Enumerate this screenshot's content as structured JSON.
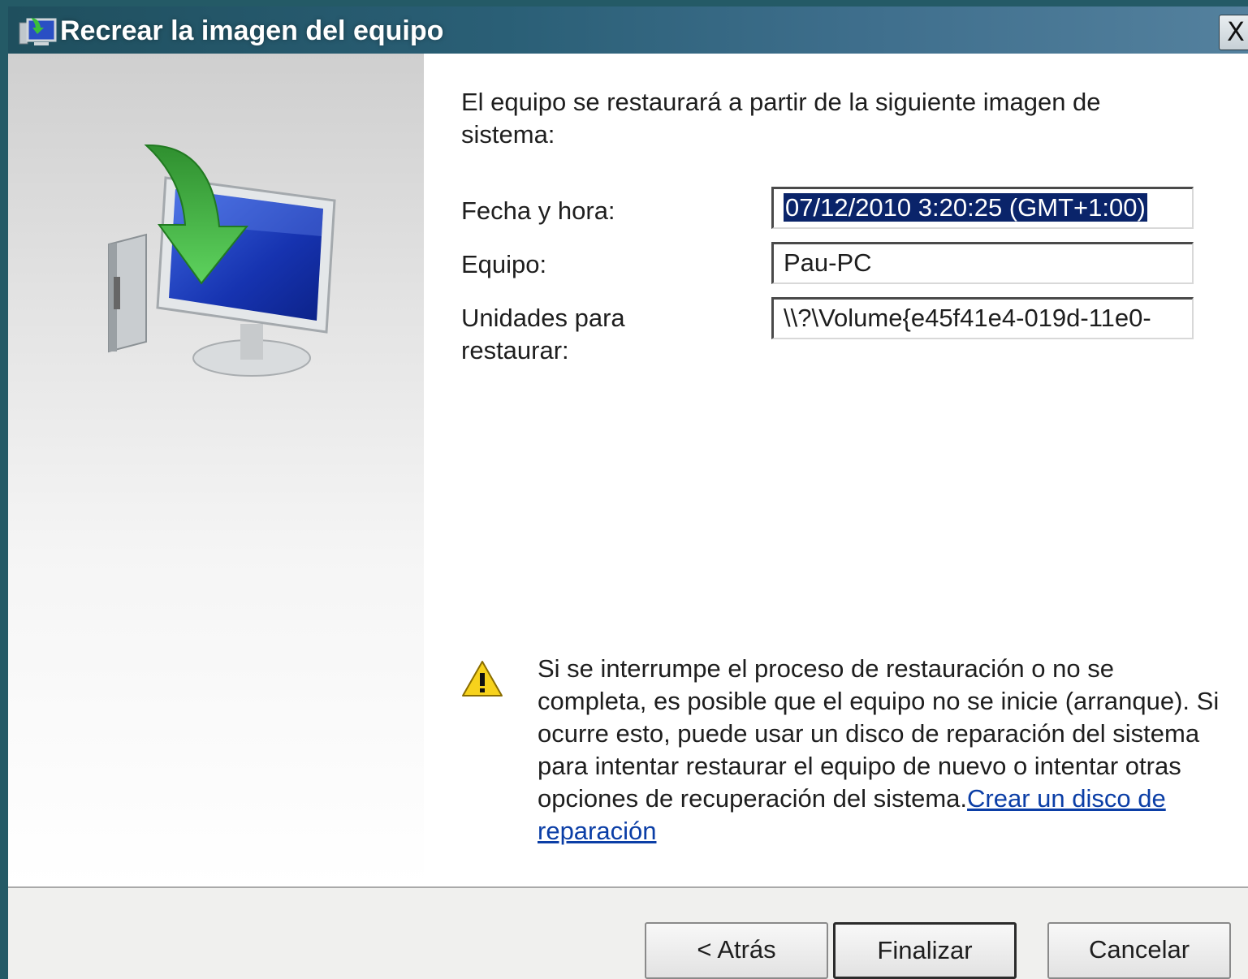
{
  "window": {
    "title": "Recrear la imagen del equipo",
    "close_label": "X"
  },
  "content": {
    "intro": "El equipo se restaurará a partir de la siguiente imagen de sistema:",
    "fields": [
      {
        "label": "Fecha y hora:",
        "value": "07/12/2010 3:20:25 (GMT+1:00)"
      },
      {
        "label": "Equipo:",
        "value": "Pau-PC"
      },
      {
        "label": "Unidades para restaurar:",
        "value": "\\\\?\\Volume{e45f41e4-019d-11e0-"
      }
    ],
    "warning_text": "Si se interrumpe el proceso de restauración o no se completa, es posible que el equipo no se inicie (arranque). Si ocurre esto, puede usar un disco de reparación del sistema para intentar restaurar el equipo de nuevo o intentar otras opciones de recuperación del sistema.",
    "warning_link": "Crear un disco de reparación"
  },
  "footer": {
    "back_label": "< Atrás",
    "finish_label": "Finalizar",
    "cancel_label": "Cancelar"
  },
  "icons": {
    "title_icon": "computer-restore-icon",
    "main_icon": "computer-restore-arrow-icon",
    "warning_icon": "warning-icon",
    "close_icon": "close-icon"
  },
  "colors": {
    "titlebar": "#2a5f76",
    "selection": "#0a246a",
    "link": "#0b3ea6"
  }
}
